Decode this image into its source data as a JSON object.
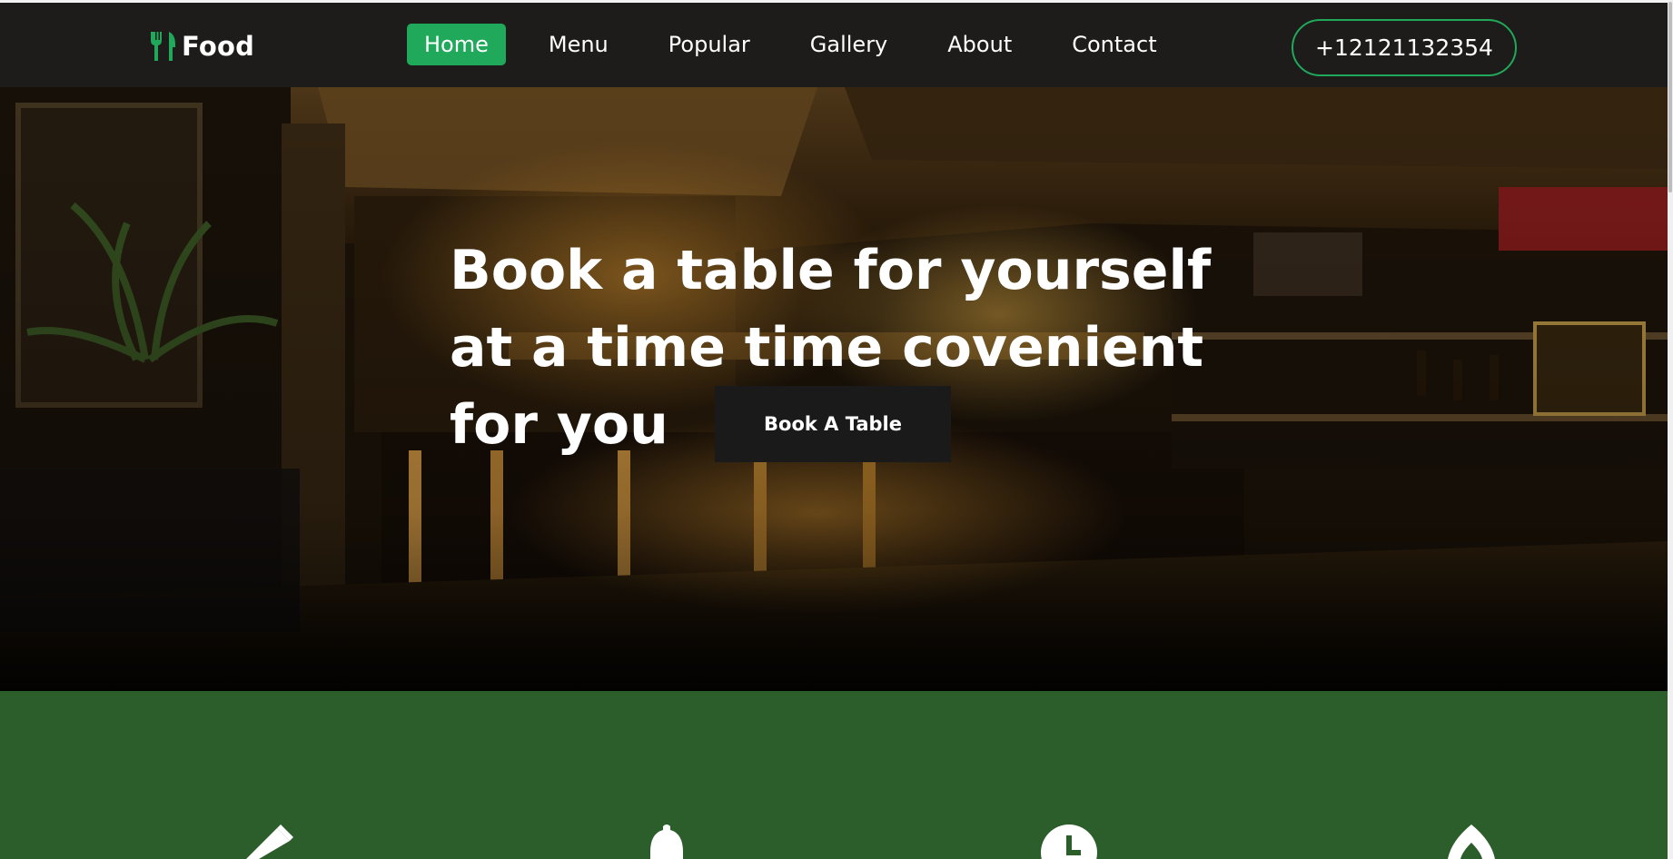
{
  "brand": {
    "name": "Food",
    "icon": "fork-knife-icon"
  },
  "nav": {
    "items": [
      {
        "label": "Home",
        "active": true
      },
      {
        "label": "Menu",
        "active": false
      },
      {
        "label": "Popular",
        "active": false
      },
      {
        "label": "Gallery",
        "active": false
      },
      {
        "label": "About",
        "active": false
      },
      {
        "label": "Contact",
        "active": false
      }
    ]
  },
  "phone": "+12121132354",
  "hero": {
    "title": "Book a table for yourself at a time time covenient for you",
    "button_label": "Book A Table"
  },
  "features": {
    "icons": [
      "pencil-icon",
      "bell-icon",
      "clock-icon",
      "fire-icon"
    ]
  },
  "colors": {
    "accent": "#20a95a",
    "navbar": "#1d1c1a",
    "feature_band": "#2c5e2c"
  }
}
